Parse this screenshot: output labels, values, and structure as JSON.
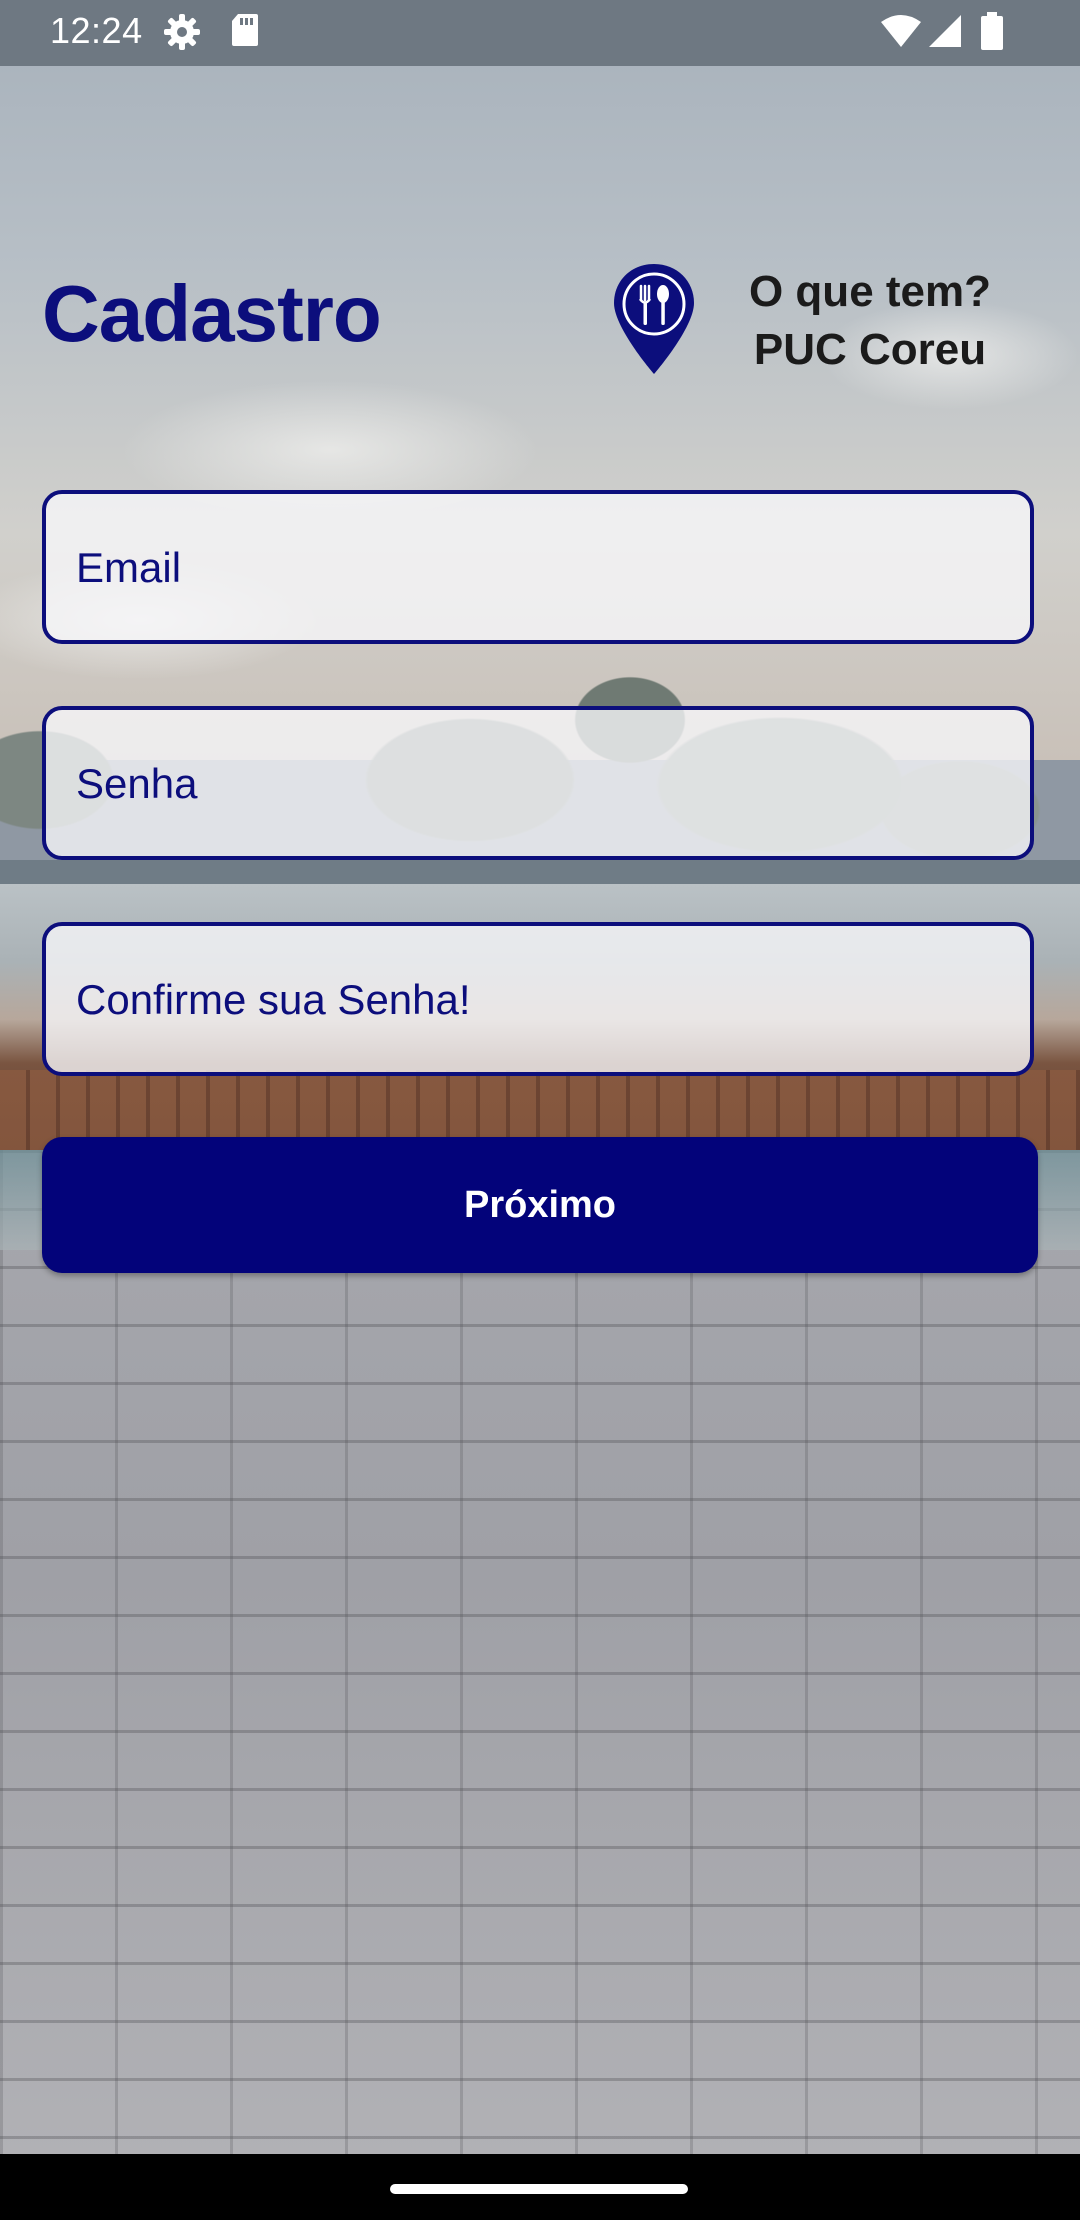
{
  "status_bar": {
    "time": "12:24",
    "icons": [
      "settings-icon",
      "sd-card-icon",
      "wifi-icon",
      "signal-icon",
      "battery-icon"
    ]
  },
  "header": {
    "title": "Cadastro",
    "logo_icon": "location-pin-fork-spoon-icon",
    "brand_line1": "O que tem?",
    "brand_line2": "PUC Coreu"
  },
  "form": {
    "email": {
      "placeholder": "Email",
      "value": ""
    },
    "password": {
      "placeholder": "Senha",
      "value": ""
    },
    "confirm_password": {
      "placeholder": "Confirme sua Senha!",
      "value": ""
    },
    "next_label": "Próximo"
  },
  "colors": {
    "accent": "#0c0e7c",
    "button": "#03037a",
    "status_bar": "#6e7882"
  }
}
